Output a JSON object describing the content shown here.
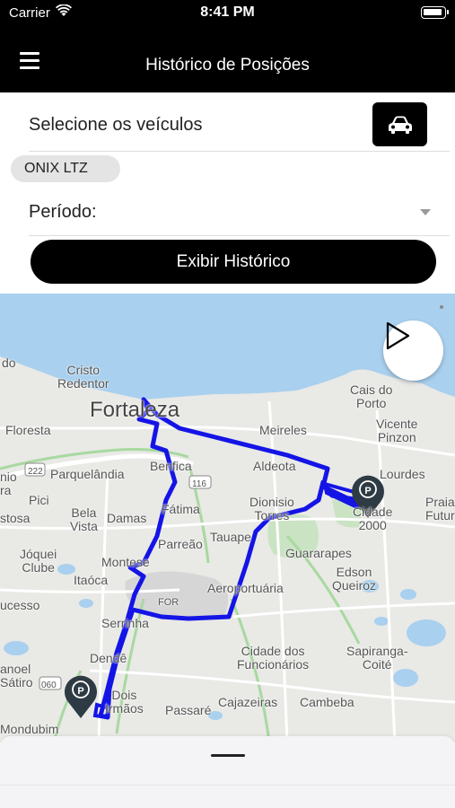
{
  "status_bar": {
    "carrier": "Carrier",
    "time": "8:41 PM"
  },
  "header": {
    "title": "Histórico de Posições",
    "menu_icon": "hamburger-menu-icon"
  },
  "vehicles": {
    "label": "Selecione os veículos",
    "button_icon": "car-icon",
    "selected_chip": "ONIX LTZ"
  },
  "period": {
    "label": "Período:"
  },
  "show_button": {
    "label": "Exibir Histórico"
  },
  "map": {
    "play_icon": "play-icon",
    "route_color": "#1414e6",
    "marker_icon": "parking-marker-icon",
    "marker_letter": "P",
    "labels": {
      "cristo_redentor": "Cristo\nRedentor",
      "fortaleza": "Fortaleza",
      "meireles": "Meireles",
      "cais_do_porto": "Cais do\nPorto",
      "vicente_pinzon": "Vicente\nPinzon",
      "do": "do",
      "floresta": "Floresta",
      "parquelandia": "Parquelândia",
      "benfica": "Benfica",
      "aldeota": "Aldeota",
      "lourdes": "Lourdes",
      "praia_futuro": "Praia\nFutur",
      "nio": "nio",
      "ra": "ra",
      "pici": "Pici",
      "bela_vista": "Bela\nVista",
      "damas": "Damas",
      "fatima": "Fátima",
      "dionisio_torres": "Dionisio\nTorres",
      "cidade_2000": "Cidade\n2000",
      "stosa": "stosa",
      "parreao": "Parreão",
      "tauape": "Tauape",
      "joquei_clube": "Jóquei\nClube",
      "montese": "Montese",
      "guararapes": "Guararapes",
      "edson_queiroz": "Edson\nQueiroz",
      "itaoca": "Itaóca",
      "aeroportuaria": "Aeroportuária",
      "for": "FOR",
      "ucesso": "ucesso",
      "serrinha": "Serrinha",
      "dende": "Dendê",
      "cidade_dos_funcionarios": "Cidade dos\nFuncionários",
      "sapiranga_coite": "Sapiranga-\nCoité",
      "anoel_satiro": "anoel\nSátiro",
      "road_060": "060",
      "road_222": "222",
      "road_116": "116",
      "pedras_dois_irmaos": "Dois\nIrmãos",
      "cajazeiras": "Cajazeiras",
      "cambeba": "Cambeba",
      "passare": "Passaré",
      "mondubim": "Mondubim"
    }
  },
  "sheet": {
    "handle": "drag-handle"
  }
}
